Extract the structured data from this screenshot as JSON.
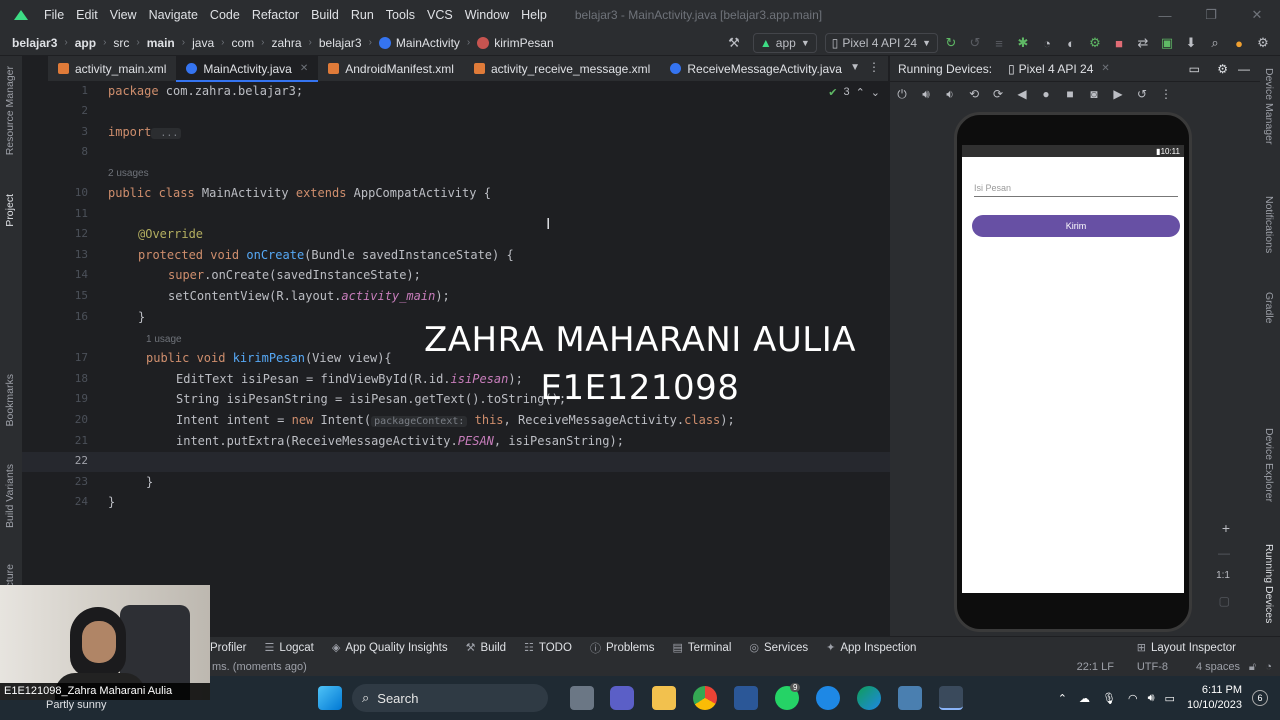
{
  "menubar": {
    "items": [
      "File",
      "Edit",
      "View",
      "Navigate",
      "Code",
      "Refactor",
      "Build",
      "Run",
      "Tools",
      "VCS",
      "Window",
      "Help"
    ],
    "window_title": "belajar3 - MainActivity.java [belajar3.app.main]",
    "controls": [
      "—",
      "❐",
      "✕"
    ]
  },
  "breadcrumb": {
    "items": [
      "belajar3",
      "app",
      "src",
      "main",
      "java",
      "com",
      "zahra",
      "belajar3",
      "MainActivity",
      "kirimPesan"
    ],
    "run_config": "app",
    "device": "Pixel 4 API 24"
  },
  "tabs": [
    {
      "label": "activity_main.xml",
      "color": "#e07b39"
    },
    {
      "label": "MainActivity.java",
      "color": "#3574f0",
      "active": true
    },
    {
      "label": "AndroidManifest.xml",
      "color": "#e07b39"
    },
    {
      "label": "activity_receive_message.xml",
      "color": "#e07b39"
    },
    {
      "label": "ReceiveMessageActivity.java",
      "color": "#3574f0"
    }
  ],
  "left_strip": {
    "resource_manager": "Resource Manager",
    "project": "Project",
    "bookmarks": "Bookmarks",
    "build_variants": "Build Variants",
    "structure": "Structure"
  },
  "right_strip": {
    "device_manager": "Device Manager",
    "notifications": "Notifications",
    "gradle": "Gradle",
    "device_explorer": "Device Explorer",
    "running_devices": "Running Devices"
  },
  "editor": {
    "inspections": "3",
    "usages": {
      "class": "2 usages",
      "method": "1 usage"
    },
    "lines": {
      "l1": "1",
      "l2": "2",
      "l3": "3",
      "l8": "8",
      "l10": "10",
      "l11": "11",
      "l12": "12",
      "l13": "13",
      "l14": "14",
      "l15": "15",
      "l16": "16",
      "l17": "17",
      "l18": "18",
      "l19": "19",
      "l20": "20",
      "l21": "21",
      "l22": "22",
      "l23": "23",
      "l24": "24"
    },
    "code": {
      "pkg_kw": "package",
      "pkg": " com.zahra.belajar3;",
      "import_kw": "import",
      "import_fold": " ...",
      "c10_kw": "public class",
      "c10_cls": " MainActivity ",
      "c10_ext": "extends",
      "c10_rest": " AppCompatActivity {",
      "c12": "@Override",
      "c13_kw": "protected void ",
      "c13_fn": "onCreate",
      "c13_rest": "(Bundle savedInstanceState) {",
      "c14_kw": "super",
      "c14_rest": ".onCreate(savedInstanceState);",
      "c15_a": "setContentView(R.layout.",
      "c15_it": "activity_main",
      "c15_b": ");",
      "c16": "}",
      "c17_kw": "public void ",
      "c17_fn": "kirimPesan",
      "c17_rest": "(View view){",
      "c18_a": "EditText isiPesan = findViewById(R.id.",
      "c18_it": "isiPesan",
      "c18_b": ");",
      "c19": "String isiPesanString = isiPesan.getText().toString();",
      "c20_a": "Intent intent = ",
      "c20_kw": "new",
      "c20_b": " Intent(",
      "c20_hint": "packageContext:",
      "c20_this": " this",
      "c20_c": ", ReceiveMessageActivity.",
      "c20_cls": "class",
      "c20_d": ");",
      "c21_a": "intent.putExtra(ReceiveMessageActivity.",
      "c21_it": "PESAN",
      "c21_b": ", isiPesanString);",
      "c23": "}",
      "c24": "}"
    }
  },
  "overlay": {
    "name": "ZAHRA MAHARANI AULIA",
    "id": "E1E121098"
  },
  "running_devices": {
    "title": "Running Devices:",
    "device_tab": "Pixel 4 API 24",
    "status_time": "10:11",
    "app_input_placeholder": "Isi Pesan",
    "app_button": "Kirim",
    "zoom": "1:1"
  },
  "bottom_bar": [
    "Profiler",
    "Logcat",
    "App Quality Insights",
    "Build",
    "TODO",
    "Problems",
    "Terminal",
    "Services",
    "App Inspection"
  ],
  "bottom_right": "Layout Inspector",
  "status": {
    "left": "ms. (moments ago)",
    "position": "22:1",
    "line_sep": "LF",
    "encoding": "UTF-8",
    "indent": "4 spaces"
  },
  "webcam": {
    "label": "E1E121098_Zahra Maharani Aulia",
    "weather": "Partly sunny"
  },
  "taskbar": {
    "search": "Search",
    "time": "6:11 PM",
    "date": "10/10/2023",
    "whatsapp_badge": "9"
  }
}
